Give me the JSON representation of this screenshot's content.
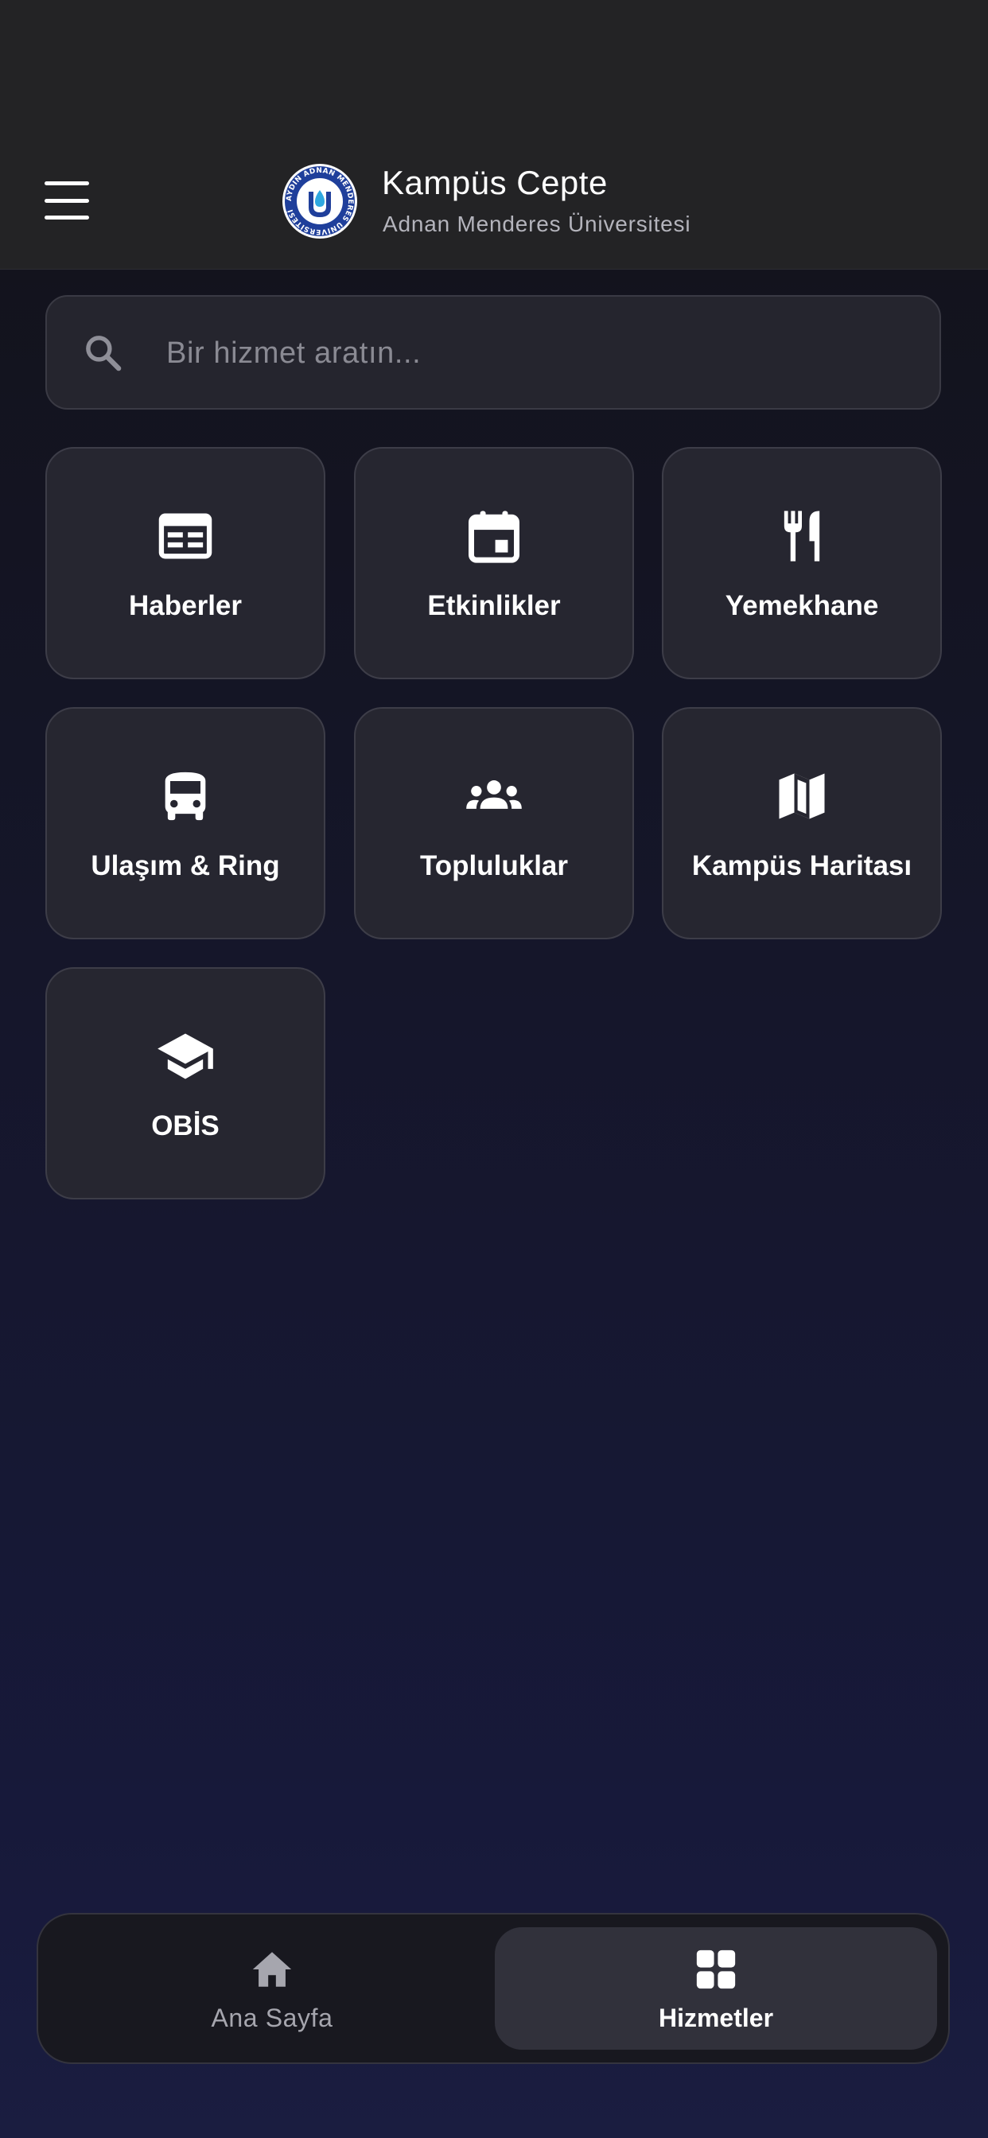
{
  "header": {
    "title": "Kampüs Cepte",
    "subtitle": "Adnan Menderes Üniversitesi",
    "menu_icon": "hamburger-menu-icon",
    "logo": "university-seal-logo",
    "logo_text": "AYDIN ADNAN MENDERES ÜNİVERSİTESİ"
  },
  "search": {
    "placeholder": "Bir hizmet aratın...",
    "value": "",
    "icon": "search-icon"
  },
  "services": [
    {
      "label": "Haberler",
      "icon": "newspaper-icon"
    },
    {
      "label": "Etkinlikler",
      "icon": "calendar-icon"
    },
    {
      "label": "Yemekhane",
      "icon": "restaurant-icon"
    },
    {
      "label": "Ulaşım & Ring",
      "icon": "bus-icon"
    },
    {
      "label": "Topluluklar",
      "icon": "groups-icon"
    },
    {
      "label": "Kampüs Haritası",
      "icon": "map-icon"
    },
    {
      "label": "OBİS",
      "icon": "graduation-cap-icon"
    }
  ],
  "bottom_nav": {
    "items": [
      {
        "label": "Ana Sayfa",
        "icon": "home-icon",
        "active": false
      },
      {
        "label": "Hizmetler",
        "icon": "grid-icon",
        "active": true
      }
    ]
  },
  "colors": {
    "header_bg": "#232325",
    "tile_bg": "#262630",
    "tile_border": "#3d3d48",
    "text_primary": "#ffffff",
    "text_secondary": "#b4b4bc",
    "active_nav_bg": "#31313b"
  }
}
